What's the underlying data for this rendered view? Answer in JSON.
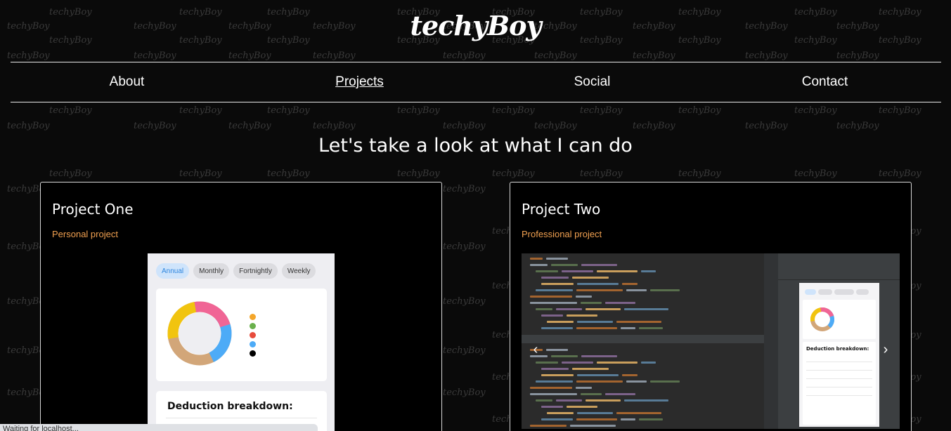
{
  "brand": {
    "logo_text": "techyBoy",
    "watermark_text": "techyBoy"
  },
  "nav": {
    "items": [
      {
        "label": "About",
        "active": false
      },
      {
        "label": "Projects",
        "active": true
      },
      {
        "label": "Social",
        "active": false
      },
      {
        "label": "Contact",
        "active": false
      }
    ]
  },
  "main": {
    "headline": "Let's take a look at what I can do",
    "projects": [
      {
        "title": "Project One",
        "subtitle": "Personal project",
        "screenshot": {
          "tabs": [
            "Annual",
            "Monthly",
            "Fortnightly",
            "Weekly"
          ],
          "selected_tab": "Annual",
          "donut_colors": [
            "#f1c40f",
            "#f06595",
            "#4dabf7",
            "#d2a679"
          ],
          "legend_colors": [
            "#f4a62a",
            "#6ab04c",
            "#e74c3c",
            "#4dabf7",
            "#000000"
          ],
          "card_title": "Deduction breakdown:"
        }
      },
      {
        "title": "Project Two",
        "subtitle": "Professional project",
        "screenshot": {
          "preview_title": "Deduction breakdown:",
          "prev_icon": "chevron-left-icon",
          "next_icon": "chevron-right-icon"
        }
      }
    ]
  },
  "status": {
    "text": "Waiting for localhost..."
  },
  "colors": {
    "accent": "#f0a050",
    "background": "#0a0a0a",
    "border": "#e6e6e6"
  }
}
